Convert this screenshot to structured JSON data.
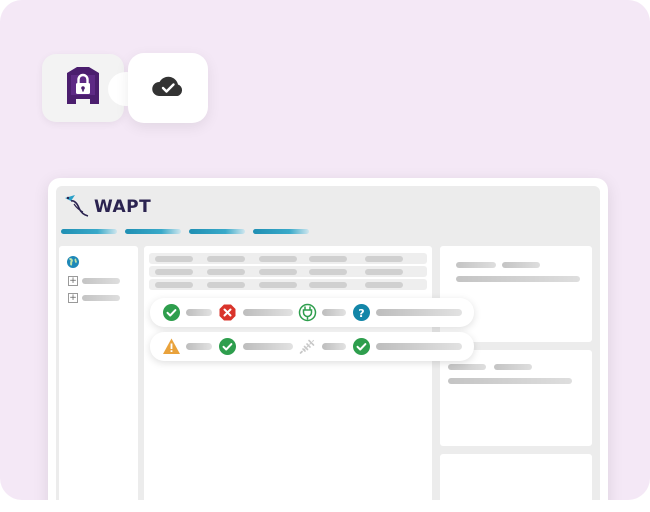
{
  "app": {
    "title": "WAPT"
  },
  "header": {
    "nav_tabs": [
      {
        "name": "nav-tab-1"
      },
      {
        "name": "nav-tab-2"
      },
      {
        "name": "nav-tab-3"
      },
      {
        "name": "nav-tab-4"
      }
    ]
  },
  "badges": {
    "left_icon": "lock-icon",
    "right_icon": "cloud-check-icon"
  },
  "status_rows": [
    [
      "ok-check-icon",
      "error-x-icon",
      "plug-icon",
      "question-icon"
    ],
    [
      "warning-icon",
      "ok-check-icon",
      "plug-off-icon",
      "ok-check-icon"
    ]
  ],
  "colors": {
    "ok": "#2e9e4d",
    "error": "#d9342b",
    "warning": "#e9a23b",
    "info": "#1386a8",
    "brand": "#4b1e6e",
    "accent": "#1f8fb3"
  }
}
